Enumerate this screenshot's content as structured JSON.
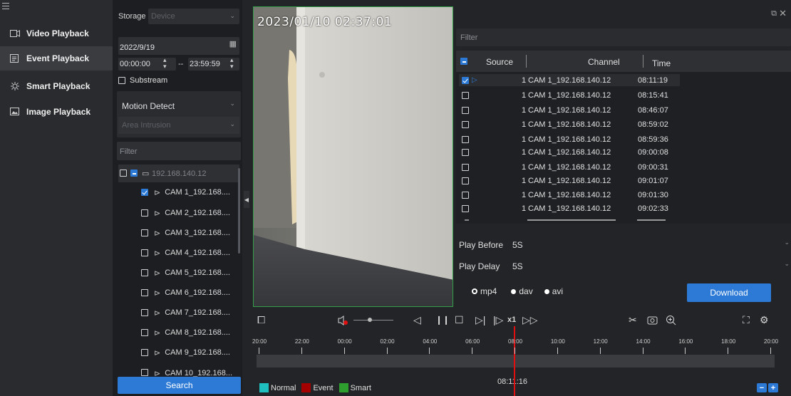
{
  "nav": {
    "items": [
      {
        "label": "Video Playback",
        "icon": "video-playback-icon"
      },
      {
        "label": "Event Playback",
        "icon": "event-playback-icon"
      },
      {
        "label": "Smart Playback",
        "icon": "smart-playback-icon"
      },
      {
        "label": "Image Playback",
        "icon": "image-playback-icon"
      }
    ]
  },
  "search_panel": {
    "storage_label": "Storage",
    "storage_value": "Device",
    "date": "2022/9/19",
    "time_start": "00:00:00",
    "time_sep": "--",
    "time_end": "23:59:59",
    "substream_label": "Substream",
    "event_type": "Motion Detect",
    "sub_type": "Area Intrusion",
    "filter_placeholder": "Filter",
    "device": "192.168.140.12",
    "cameras": [
      "CAM 1_192.168....",
      "CAM 2_192.168....",
      "CAM 3_192.168....",
      "CAM 4_192.168....",
      "CAM 5_192.168....",
      "CAM 6_192.168....",
      "CAM 7_192.168....",
      "CAM 8_192.168....",
      "CAM 9_192.168....",
      "CAM 10_192.168..."
    ],
    "search_button": "Search"
  },
  "video": {
    "timestamp": "2023/01/10 02:37:01"
  },
  "events": {
    "filter_placeholder": "Filter",
    "columns": {
      "source": "Source",
      "channel": "Channel",
      "time": "Time"
    },
    "rows": [
      {
        "num": "1",
        "channel": "CAM 1_192.168.140.12",
        "time": "08:11:19",
        "checked": true
      },
      {
        "num": "1",
        "channel": "CAM 1_192.168.140.12",
        "time": "08:15:41",
        "checked": false
      },
      {
        "num": "1",
        "channel": "CAM 1_192.168.140.12",
        "time": "08:46:07",
        "checked": false
      },
      {
        "num": "1",
        "channel": "CAM 1_192.168.140.12",
        "time": "08:59:02",
        "checked": false
      },
      {
        "num": "1",
        "channel": "CAM 1_192.168.140.12",
        "time": "08:59:36",
        "checked": false
      },
      {
        "num": "1",
        "channel": "CAM 1_192.168.140.12",
        "time": "09:00:08",
        "checked": false
      },
      {
        "num": "1",
        "channel": "CAM 1_192.168.140.12",
        "time": "09:00:31",
        "checked": false
      },
      {
        "num": "1",
        "channel": "CAM 1_192.168.140.12",
        "time": "09:01:07",
        "checked": false
      },
      {
        "num": "1",
        "channel": "CAM 1_192.168.140.12",
        "time": "09:01:30",
        "checked": false
      },
      {
        "num": "1",
        "channel": "CAM 1_192.168.140.12",
        "time": "09:02:33",
        "checked": false
      }
    ],
    "play_before_label": "Play Before",
    "play_before_value": "5S",
    "play_delay_label": "Play Delay",
    "play_delay_value": "5S",
    "formats": [
      "mp4",
      "dav",
      "avi"
    ],
    "selected_format": "mp4",
    "download_button": "Download"
  },
  "controls": {
    "speed": "x1",
    "current_time": "08:11:16"
  },
  "timeline": {
    "ticks": [
      "20:00",
      "22:00",
      "00:00",
      "02:00",
      "04:00",
      "06:00",
      "08:00",
      "10:00",
      "12:00",
      "14:00",
      "16:00",
      "18:00",
      "20:00"
    ]
  },
  "legend": [
    {
      "label": "Normal",
      "color": "#1fbfbf"
    },
    {
      "label": "Event",
      "color": "#a40000"
    },
    {
      "label": "Smart",
      "color": "#2e9e2e"
    }
  ],
  "colors": {
    "accent": "#2d7ad6",
    "playhead": "#e01010",
    "video_border": "#35a04a"
  }
}
